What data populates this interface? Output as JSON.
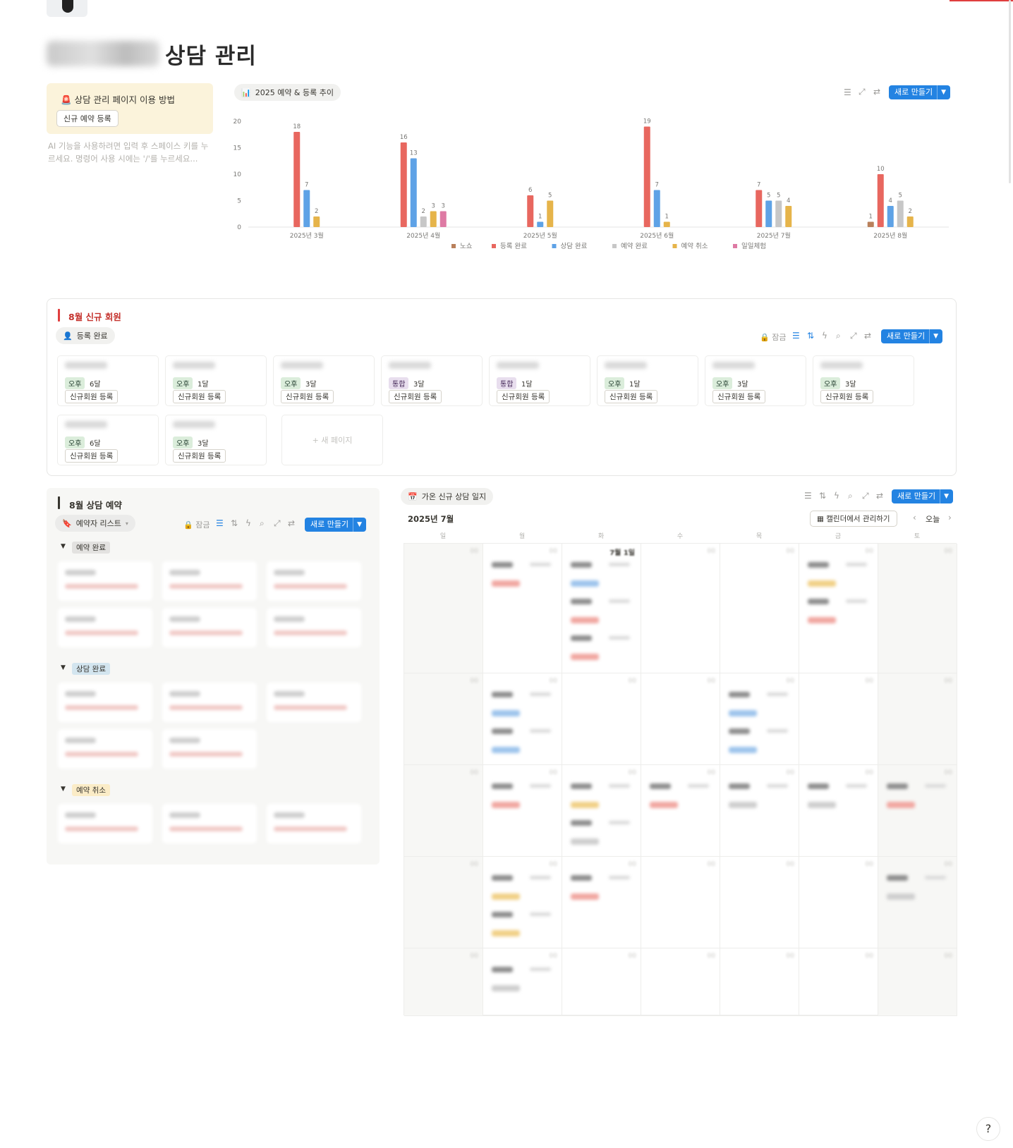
{
  "page": {
    "title": "상담 관리"
  },
  "callout": {
    "title": "상담 관리 페이지 이용 방법",
    "button": "신규 예약 등록"
  },
  "hint": "AI 기능을 사용하려면 입력 후 스페이스 키를 누르세요. 명령어 사용 시에는 '/'를 누르세요...",
  "chart_tab": "2025 예약 & 등록 추이",
  "new_button": "새로 만들기",
  "lock_label": "잠금",
  "chart_data": {
    "type": "bar",
    "categories": [
      "2025년 3월",
      "2025년 4월",
      "2025년 5월",
      "2025년 6월",
      "2025년 7월",
      "2025년 8월"
    ],
    "series": [
      {
        "name": "노쇼",
        "color": "#b9805b",
        "values": [
          0,
          0,
          0,
          0,
          0,
          1
        ]
      },
      {
        "name": "등록 완료",
        "color": "#e8675f",
        "values": [
          18,
          16,
          6,
          19,
          7,
          10
        ]
      },
      {
        "name": "상담 완료",
        "color": "#5ea2e6",
        "values": [
          7,
          13,
          1,
          7,
          5,
          4
        ]
      },
      {
        "name": "예약 완료",
        "color": "#c7c7c7",
        "values": [
          0,
          2,
          0,
          0,
          5,
          5
        ]
      },
      {
        "name": "예약 취소",
        "color": "#e6b44a",
        "values": [
          2,
          3,
          5,
          1,
          4,
          2
        ]
      },
      {
        "name": "일일체험",
        "color": "#de7aa4",
        "values": [
          0,
          3,
          0,
          0,
          0,
          0
        ]
      }
    ],
    "yticks": [
      0,
      5,
      10,
      15,
      20
    ],
    "ylim": [
      0,
      20
    ],
    "legend": "bottom",
    "grid": false
  },
  "members": {
    "title": "8월 신규 회원",
    "view": "등록 완료",
    "new_page": "+ 새 페이지",
    "cards": [
      {
        "time": "오후",
        "period": "6달",
        "status": "신규회원 등록",
        "tone": "green"
      },
      {
        "time": "오후",
        "period": "1달",
        "status": "신규회원 등록",
        "tone": "green"
      },
      {
        "time": "오후",
        "period": "3달",
        "status": "신규회원 등록",
        "tone": "green"
      },
      {
        "time": "통합",
        "period": "3달",
        "status": "신규회원 등록",
        "tone": "purple"
      },
      {
        "time": "통합",
        "period": "1달",
        "status": "신규회원 등록",
        "tone": "purple"
      },
      {
        "time": "오후",
        "period": "1달",
        "status": "신규회원 등록",
        "tone": "green"
      },
      {
        "time": "오후",
        "period": "3달",
        "status": "신규회원 등록",
        "tone": "green"
      },
      {
        "time": "오후",
        "period": "3달",
        "status": "신규회원 등록",
        "tone": "green"
      },
      {
        "time": "오후",
        "period": "6달",
        "status": "신규회원 등록",
        "tone": "green"
      },
      {
        "time": "오후",
        "period": "3달",
        "status": "신규회원 등록",
        "tone": "green"
      }
    ]
  },
  "reservations": {
    "title": "8월 상담 예약",
    "view": "예약자 리스트",
    "groups": [
      {
        "label": "예약 완료",
        "color": "#e3e2e0"
      },
      {
        "label": "상담 완료",
        "color": "#d3e5ef"
      },
      {
        "label": "예약 취소",
        "color": "#fbecc7"
      }
    ]
  },
  "calendar": {
    "tab": "가온 신규 상담 일지",
    "month": "2025년 7월",
    "manage": "캘린더에서 관리하기",
    "today": "오늘",
    "weekdays": [
      "일",
      "월",
      "화",
      "수",
      "목",
      "금",
      "토"
    ],
    "first_label": "7월 1일"
  }
}
